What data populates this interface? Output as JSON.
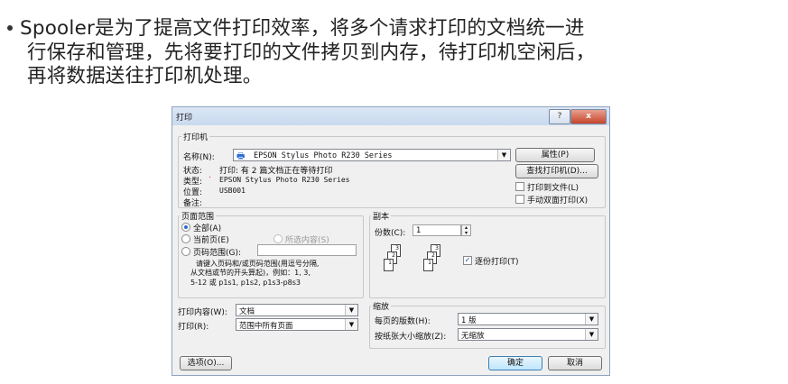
{
  "slide": {
    "line1": "Spooler是为了提高文件打印效率，将多个请求打印的文档统一进",
    "line2": "行保存和管理，先将要打印的文件拷贝到内存，待打印机空闲后，",
    "line3": "再将数据送往打印机处理。"
  },
  "dialog": {
    "title": "打印",
    "help_label": "?",
    "close_label": "x",
    "printer": {
      "group_label": "打印机",
      "name_label": "名称(N):",
      "name_value": "EPSON Stylus Photo R230 Series",
      "status_label": "状态:",
      "status_value": "打印: 有 2 篇文档正在等待打印",
      "type_label": "类型:",
      "type_value": "EPSON Stylus Photo R230 Series",
      "where_label": "位置:",
      "where_value": "USB001",
      "comment_label": "备注:",
      "properties_button": "属性(P)",
      "find_printer_button": "查找打印机(D)...",
      "print_to_file_label": "打印到文件(L)",
      "manual_duplex_label": "手动双面打印(X)"
    },
    "range": {
      "group_label": "页面范围",
      "all_label": "全部(A)",
      "current_label": "当前页(E)",
      "selection_label": "所选内容(S)",
      "pages_label": "页码范围(G):",
      "hint1": "请键入页码和/或页码范围(用逗号分隔,",
      "hint2": "从文档或节的开头算起)，例如：1, 3,",
      "hint3": "5-12 或 p1s1, p1s2, p1s3-p8s3"
    },
    "copies": {
      "group_label": "副本",
      "count_label": "份数(C):",
      "count_value": "1",
      "collate_label": "逐份打印(T)",
      "collate_checked": true,
      "page_numbers": [
        "3",
        "2",
        "1",
        "3",
        "2",
        "1"
      ]
    },
    "print_what_label": "打印内容(W):",
    "print_what_value": "文档",
    "print_label": "打印(R):",
    "print_value": "范围中所有页面",
    "zoom": {
      "group_label": "缩放",
      "pages_per_sheet_label": "每页的版数(H):",
      "pages_per_sheet_value": "1 版",
      "scale_label": "按纸张大小缩放(Z):",
      "scale_value": "无缩放"
    },
    "options_button": "选项(O)...",
    "ok_button": "确定",
    "cancel_button": "取消"
  }
}
